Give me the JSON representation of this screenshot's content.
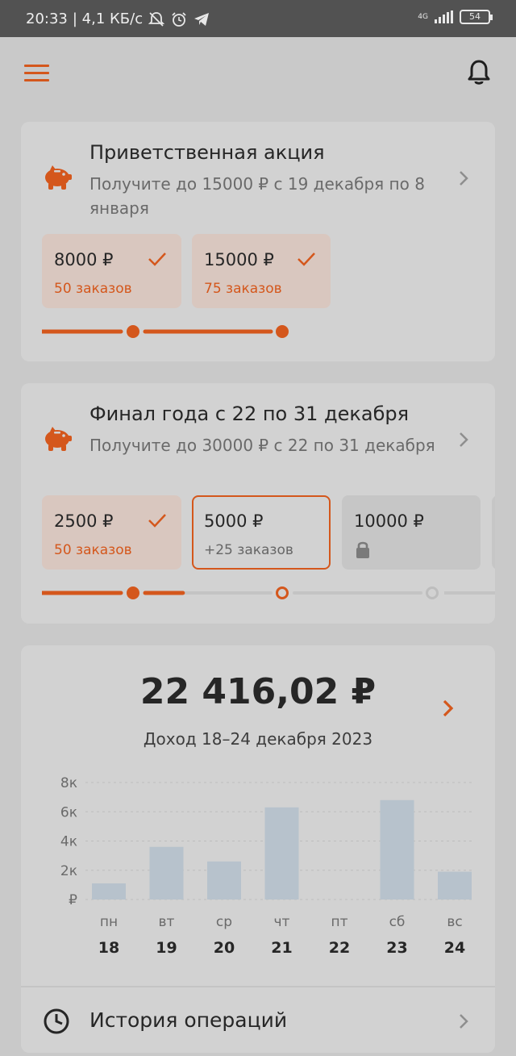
{
  "status": {
    "time": "20:33",
    "speed": "| 4,1 КБ/с",
    "network": "4G",
    "battery": "54"
  },
  "icons": {
    "menu": "hamburger-icon",
    "bell": "bell-icon",
    "promo": "piggy-bank-icon",
    "chevron": "chevron-right-icon",
    "check": "check-icon",
    "lock": "lock-icon",
    "history": "clock-icon"
  },
  "colors": {
    "accent": "#d4571c",
    "card": "#d2d2d2",
    "bar": "#b7c2cc"
  },
  "promo1": {
    "title": "Приветственная акция",
    "desc": "Получите до 15000 ₽ с 19 декабря по 8 января",
    "tiers": [
      {
        "amount": "8000 ₽",
        "sub": "50 заказов",
        "state": "done"
      },
      {
        "amount": "15000 ₽",
        "sub": "75 заказов",
        "state": "done"
      }
    ]
  },
  "promo2": {
    "title": "Финал года с 22 по 31 декабря",
    "desc": "Получите до 30000 ₽ с 22 по 31 декабря",
    "tiers": [
      {
        "amount": "2500 ₽",
        "sub": "50 заказов",
        "state": "done"
      },
      {
        "amount": "5000 ₽",
        "sub": "+25 заказов",
        "state": "current"
      },
      {
        "amount": "10000 ₽",
        "sub": "",
        "state": "locked"
      }
    ],
    "progress": 0.3
  },
  "income": {
    "total": "22 416,02 ₽",
    "period": "Доход 18–24 декабря 2023"
  },
  "chart_data": {
    "type": "bar",
    "categories": [
      "пн",
      "вт",
      "ср",
      "чт",
      "пт",
      "сб",
      "вс"
    ],
    "dates": [
      "18",
      "19",
      "20",
      "21",
      "22",
      "23",
      "24"
    ],
    "values": [
      1100,
      3600,
      2600,
      6300,
      0,
      6800,
      1900
    ],
    "yticks": [
      "₽",
      "2к",
      "4к",
      "6к",
      "8к"
    ],
    "ylim": [
      0,
      8000
    ],
    "grid": true
  },
  "history": {
    "label": "История операций"
  }
}
